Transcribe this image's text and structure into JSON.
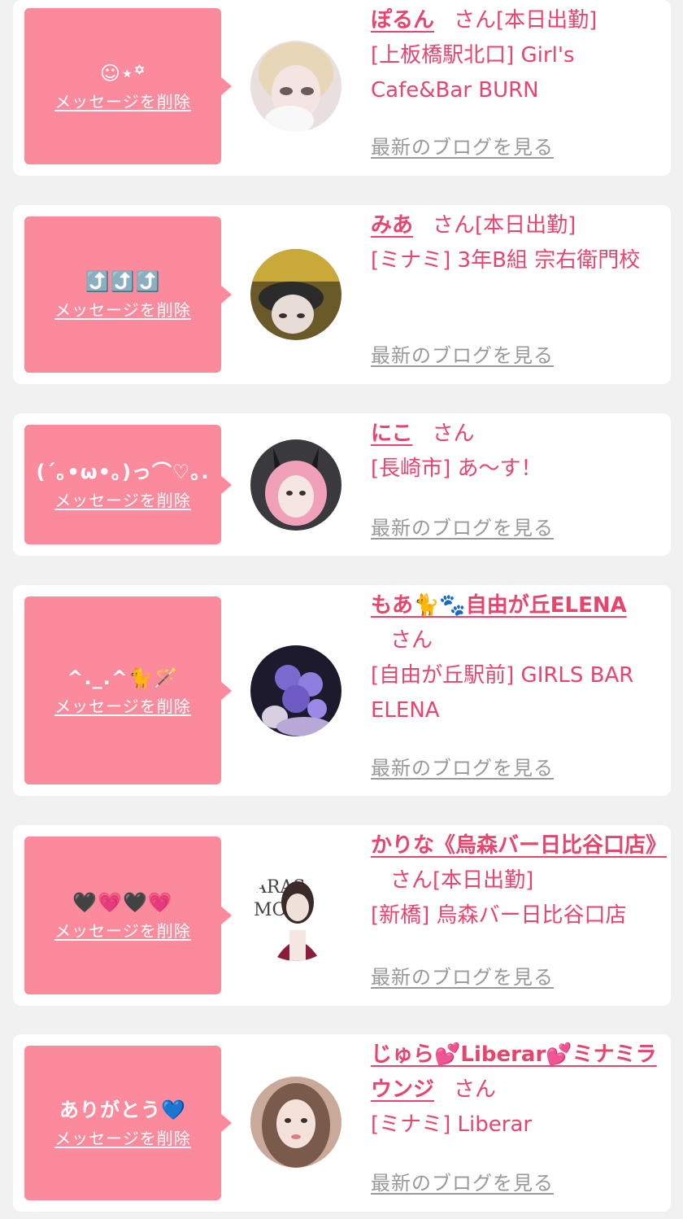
{
  "delete_label": "メッセージを削除",
  "blog_label": "最新のブログを見る",
  "colors": {
    "accent": "#e8446c",
    "bubble": "#fb8a9c",
    "muted": "#999999",
    "background": "#f1f1f1"
  },
  "cards": [
    {
      "message": "☺︎⋆꙳",
      "name": "ぽるん",
      "honorific": "さん",
      "status": "[本日出勤]",
      "shop": "[上板橋駅北口] Girl's Cafe&Bar BURN"
    },
    {
      "message": "⤴️⤴️⤴️",
      "name": "みあ",
      "honorific": "さん",
      "status": "[本日出勤]",
      "shop": "[ミナミ] 3年B組 宗右衛門校"
    },
    {
      "message": "(´｡•ω•｡)っ⌒♡｡.",
      "name": "にこ",
      "honorific": "さん",
      "status": "",
      "shop": "[長崎市] あ〜す！"
    },
    {
      "message": "^._.^🐈🪄",
      "name": "もあ🐈🐾自由が丘ELENA",
      "honorific": "さん",
      "status": "",
      "shop": "[自由が丘駅前] GIRLS BAR ELENA"
    },
    {
      "message": "🖤💗🖤💗",
      "name": "かりな《烏森バー日比谷口店》",
      "honorific": "さん",
      "status": "[本日出勤]",
      "shop": "[新橋] 烏森バー日比谷口店"
    },
    {
      "message": "ありがとう💙",
      "name": "じゅら💕Liberar💕ミナミラウンジ",
      "honorific": "さん",
      "status": "",
      "shop": "[ミナミ] Liberar"
    }
  ]
}
